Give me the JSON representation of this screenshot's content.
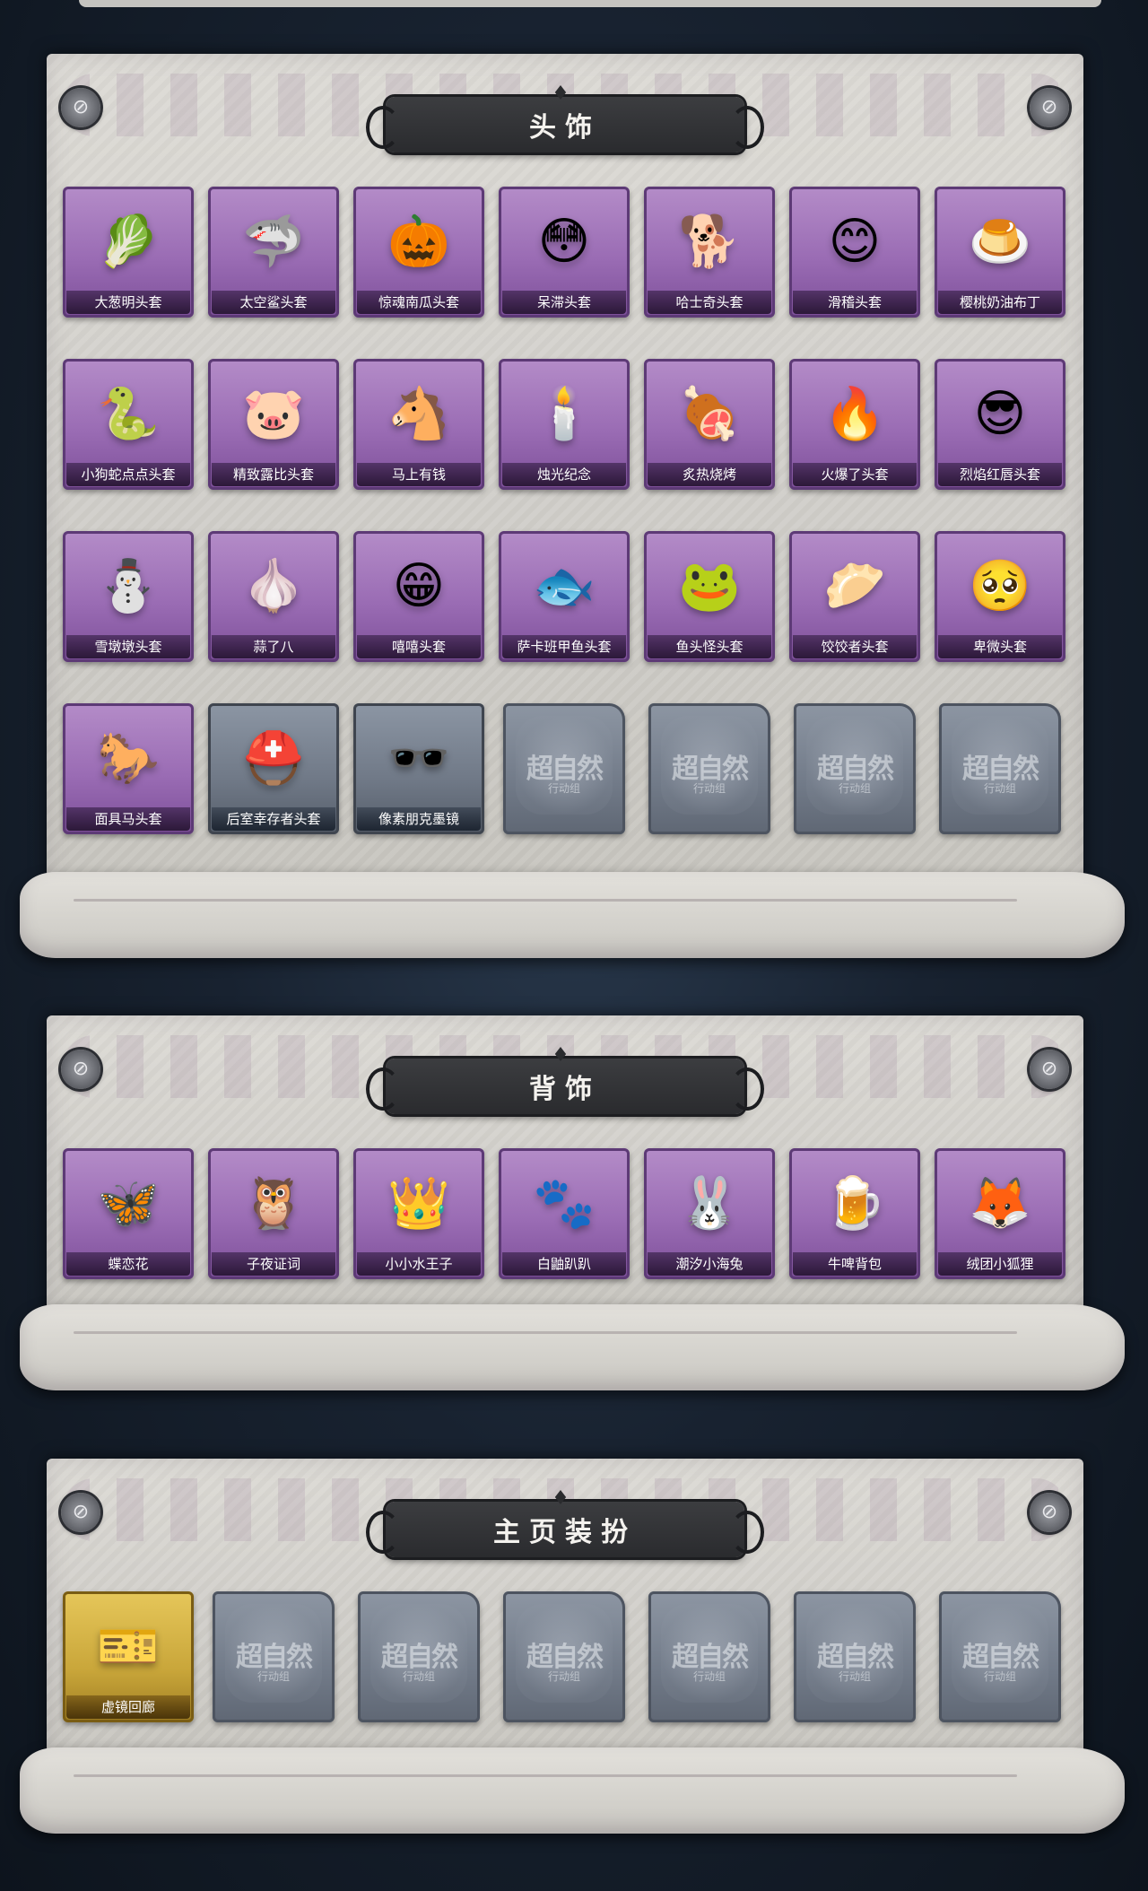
{
  "sections": [
    {
      "title": "头饰",
      "items": [
        {
          "label": "大葱明头套",
          "icon": "🥬",
          "icon_name": "scallion-head-icon",
          "rarity": "purple"
        },
        {
          "label": "太空鲨头套",
          "icon": "🦈",
          "icon_name": "shark-head-icon",
          "rarity": "purple"
        },
        {
          "label": "惊魂南瓜头套",
          "icon": "🎃",
          "icon_name": "pumpkin-head-icon",
          "rarity": "purple"
        },
        {
          "label": "呆滞头套",
          "icon": "😳",
          "icon_name": "dazed-face-icon",
          "rarity": "purple"
        },
        {
          "label": "哈士奇头套",
          "icon": "🐕",
          "icon_name": "husky-head-icon",
          "rarity": "purple"
        },
        {
          "label": "滑稽头套",
          "icon": "😊",
          "icon_name": "funny-face-icon",
          "rarity": "purple"
        },
        {
          "label": "樱桃奶油布丁",
          "icon": "🍮",
          "icon_name": "pudding-icon",
          "rarity": "purple"
        },
        {
          "label": "小狗蛇点点头套",
          "icon": "🐍",
          "icon_name": "snake-head-icon",
          "rarity": "purple"
        },
        {
          "label": "精致露比头套",
          "icon": "🐷",
          "icon_name": "ruby-head-icon",
          "rarity": "purple"
        },
        {
          "label": "马上有钱",
          "icon": "🐴",
          "icon_name": "horse-money-icon",
          "rarity": "purple"
        },
        {
          "label": "烛光纪念",
          "icon": "🕯️",
          "icon_name": "candle-icon",
          "rarity": "purple"
        },
        {
          "label": "炙热烧烤",
          "icon": "🍖",
          "icon_name": "barbecue-icon",
          "rarity": "purple"
        },
        {
          "label": "火爆了头套",
          "icon": "🔥",
          "icon_name": "fire-head-icon",
          "rarity": "purple"
        },
        {
          "label": "烈焰红唇头套",
          "icon": "😎",
          "icon_name": "red-lips-head-icon",
          "rarity": "purple"
        },
        {
          "label": "雪墩墩头套",
          "icon": "⛄",
          "icon_name": "snowman-head-icon",
          "rarity": "purple"
        },
        {
          "label": "蒜了八",
          "icon": "🧄",
          "icon_name": "garlic-icon",
          "rarity": "purple"
        },
        {
          "label": "嘻嘻头套",
          "icon": "😁",
          "icon_name": "grin-face-icon",
          "rarity": "purple"
        },
        {
          "label": "萨卡班甲鱼头套",
          "icon": "🐟",
          "icon_name": "fish-head-icon",
          "rarity": "purple"
        },
        {
          "label": "鱼头怪头套",
          "icon": "🐸",
          "icon_name": "fish-monster-head-icon",
          "rarity": "purple"
        },
        {
          "label": "饺饺者头套",
          "icon": "🥟",
          "icon_name": "dumpling-head-icon",
          "rarity": "purple"
        },
        {
          "label": "卑微头套",
          "icon": "🥺",
          "icon_name": "humble-face-icon",
          "rarity": "purple"
        },
        {
          "label": "面具马头套",
          "icon": "🐎",
          "icon_name": "horse-mask-icon",
          "rarity": "purple"
        },
        {
          "label": "后室幸存者头套",
          "icon": "⛑️",
          "icon_name": "gas-mask-helmet-icon",
          "rarity": "gray"
        },
        {
          "label": "像素朋克墨镜",
          "icon": "🕶️",
          "icon_name": "pixel-sunglasses-icon",
          "rarity": "gray"
        }
      ],
      "empty_count": 4
    },
    {
      "title": "背饰",
      "items": [
        {
          "label": "蝶恋花",
          "icon": "🦋",
          "icon_name": "butterfly-wreath-icon",
          "rarity": "purple"
        },
        {
          "label": "子夜证词",
          "icon": "🦉",
          "icon_name": "midnight-doll-icon",
          "rarity": "purple"
        },
        {
          "label": "小小水王子",
          "icon": "👑",
          "icon_name": "water-prince-icon",
          "rarity": "purple"
        },
        {
          "label": "白鼬趴趴",
          "icon": "🐾",
          "icon_name": "white-ferret-icon",
          "rarity": "purple"
        },
        {
          "label": "潮汐小海兔",
          "icon": "🐰",
          "icon_name": "sea-bunny-icon",
          "rarity": "purple"
        },
        {
          "label": "牛啤背包",
          "icon": "🍺",
          "icon_name": "beer-backpack-icon",
          "rarity": "purple"
        },
        {
          "label": "绒团小狐狸",
          "icon": "🦊",
          "icon_name": "fluffy-fox-icon",
          "rarity": "purple"
        }
      ],
      "empty_count": 0
    },
    {
      "title": "主页装扮",
      "items": [
        {
          "label": "虚镜回廊",
          "icon": "🎫",
          "icon_name": "mirror-card-icon",
          "rarity": "gold"
        }
      ],
      "empty_count": 6
    }
  ],
  "empty_slot": {
    "title": "超自然",
    "subtitle": "行动组"
  }
}
